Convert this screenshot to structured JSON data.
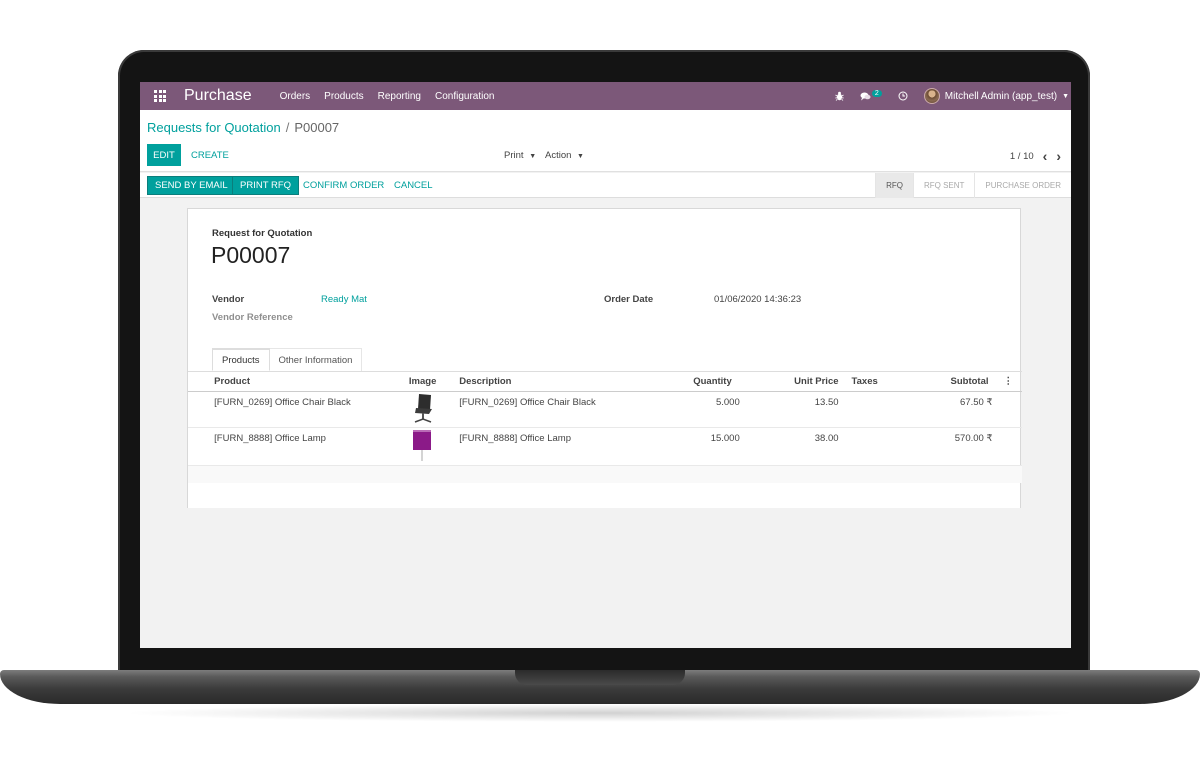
{
  "navbar": {
    "app_title": "Purchase",
    "menu": [
      "Orders",
      "Products",
      "Reporting",
      "Configuration"
    ],
    "messages_count": "2",
    "user_name": "Mitchell Admin (app_test)",
    "icons": [
      "apps-grid-icon",
      "bug-icon",
      "chat-icon",
      "clock-icon",
      "caret-down-icon"
    ]
  },
  "breadcrumb": {
    "parent": "Requests for Quotation",
    "separator": "/",
    "current": "P00007"
  },
  "control_panel": {
    "edit_label": "EDIT",
    "create_label": "CREATE",
    "print_label": "Print",
    "action_label": "Action",
    "pager": "1 / 10"
  },
  "statusbar": {
    "send_by_email": "SEND BY EMAIL",
    "print_rfq": "PRINT RFQ",
    "confirm_order": "CONFIRM ORDER",
    "cancel": "CANCEL",
    "stages": [
      "RFQ",
      "RFQ SENT",
      "PURCHASE ORDER"
    ],
    "active_stage": "RFQ"
  },
  "sheet": {
    "doc_label": "Request for Quotation",
    "doc_name": "P00007",
    "vendor_label": "Vendor",
    "vendor_value": "Ready Mat",
    "vendor_ref_label": "Vendor Reference",
    "order_date_label": "Order Date",
    "order_date_value": "01/06/2020 14:36:23",
    "tabs": [
      "Products",
      "Other Information"
    ]
  },
  "lines": {
    "columns": {
      "product": "Product",
      "image": "Image",
      "description": "Description",
      "quantity": "Quantity",
      "unit_price": "Unit Price",
      "taxes": "Taxes",
      "subtotal": "Subtotal"
    },
    "rows": [
      {
        "product": "[FURN_0269] Office Chair Black",
        "image": "office-chair-image",
        "description": "[FURN_0269] Office Chair Black",
        "quantity": "5.000",
        "unit_price": "13.50",
        "taxes": "",
        "subtotal": "67.50 ₹"
      },
      {
        "product": "[FURN_8888] Office Lamp",
        "image": "office-lamp-image",
        "description": "[FURN_8888] Office Lamp",
        "quantity": "15.000",
        "unit_price": "38.00",
        "taxes": "",
        "subtotal": "570.00 ₹"
      }
    ]
  },
  "colors": {
    "navbar": "#7c5879",
    "accent": "#00a09d"
  }
}
